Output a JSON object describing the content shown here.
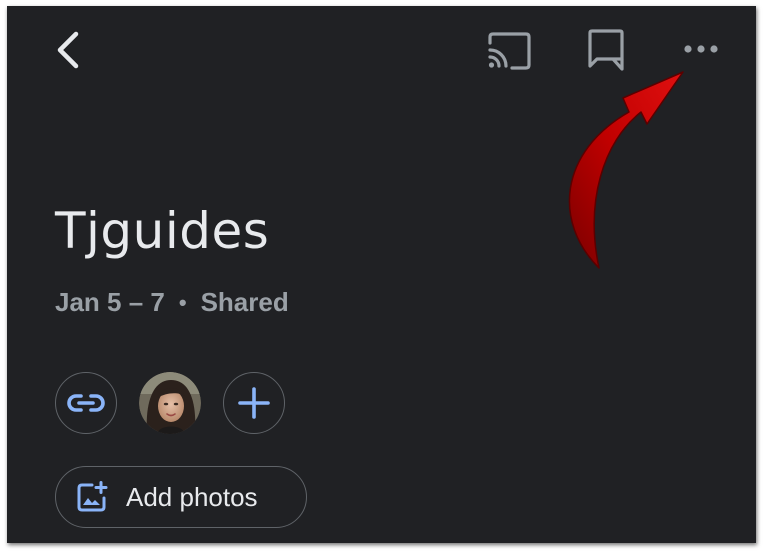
{
  "toolbar": {
    "back_icon": "arrow-back-icon",
    "cast_icon": "cast-icon",
    "comment_icon": "comment-icon",
    "more_icon": "more-horizontal-icon"
  },
  "album": {
    "title": "Tjguides",
    "date_range": "Jan 5 – 7",
    "separator": "•",
    "status": "Shared"
  },
  "people_row": {
    "link_icon": "link-icon",
    "avatar": "user-avatar",
    "add_icon": "add-person-icon"
  },
  "add_photos": {
    "label": "Add photos",
    "icon": "add-photo-icon"
  },
  "colors": {
    "background": "#202124",
    "text_primary": "#e8eaed",
    "text_secondary": "#9aa0a6",
    "accent_blue": "#8ab4f8",
    "outline": "#5f6368",
    "annotation_arrow": "#c00000"
  }
}
